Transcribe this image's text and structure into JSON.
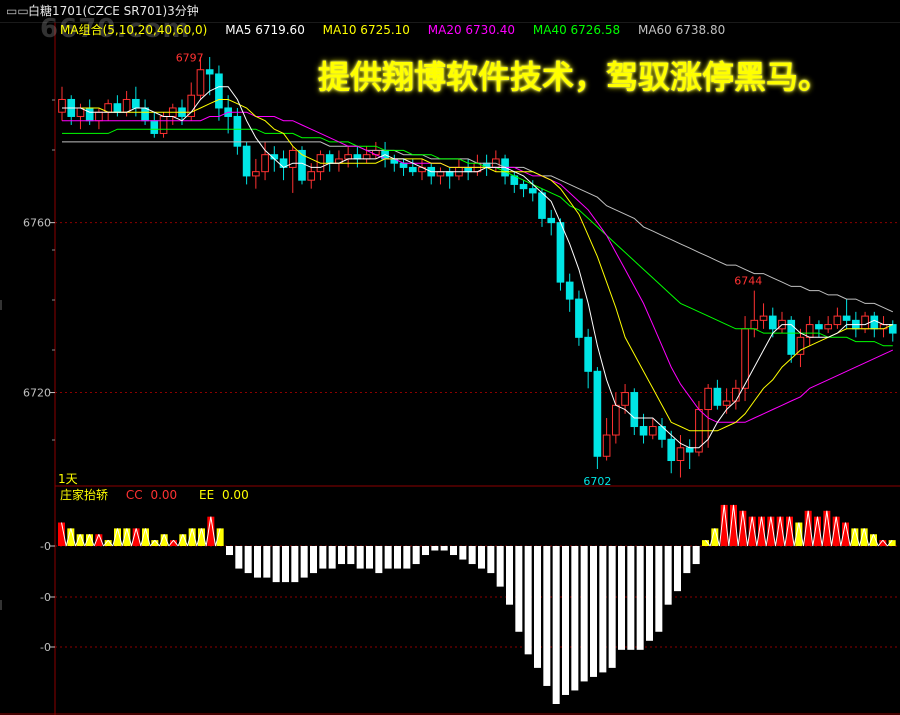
{
  "title_bar": {
    "icon": "window-icon",
    "text": "白糖1701(CZCE SR701)3分钟"
  },
  "watermark": "6670.com",
  "promo_text": "提供翔博软件技术，驾驭涨停黑马。",
  "ma_legend": {
    "group_label": "MA组合(5,10,20,40,60,0)",
    "ma5": "MA5 6719.60",
    "ma10": "MA10 6725.10",
    "ma20": "MA20 6730.40",
    "ma40": "MA40 6726.58",
    "ma60": "MA60 6738.80"
  },
  "period_label": "1天",
  "indicator_legend": {
    "name": "庄家抬轿",
    "cc": "CC",
    "cc_value": "0.00",
    "ee": "EE",
    "ee_value": "0.00"
  },
  "colors": {
    "up": "#ff3232",
    "down": "#00e5e5",
    "ma5": "#ffffff",
    "ma10": "#ffff00",
    "ma20": "#ff00ff",
    "ma40": "#00ff00",
    "ma60": "#c0c0c0",
    "grid": "#8b0000",
    "bar_pos_red": "#ff0000",
    "bar_pos_yellow": "#ffff00",
    "bar_neg": "#ffffff"
  },
  "chart_data": [
    {
      "type": "candlestick",
      "title": "白糖1701(CZCE SR701)3分钟",
      "y_ticks": [
        6720,
        6760
      ],
      "ylim": [
        6698,
        6803
      ],
      "annotations": [
        {
          "label": "6797",
          "value": 6797
        },
        {
          "label": "6744",
          "value": 6744
        },
        {
          "label": "6702",
          "value": 6702
        }
      ],
      "candles": [
        [
          6786,
          6789,
          6792,
          6784
        ],
        [
          6789,
          6785,
          6790,
          6783
        ],
        [
          6785,
          6787,
          6788,
          6782
        ],
        [
          6787,
          6784,
          6789,
          6783
        ],
        [
          6784,
          6786,
          6787,
          6782
        ],
        [
          6786,
          6788,
          6789,
          6784
        ],
        [
          6788,
          6786,
          6790,
          6785
        ],
        [
          6786,
          6789,
          6791,
          6785
        ],
        [
          6789,
          6787,
          6792,
          6785
        ],
        [
          6787,
          6784,
          6789,
          6783
        ],
        [
          6784,
          6781,
          6786,
          6780
        ],
        [
          6781,
          6785,
          6786,
          6780
        ],
        [
          6785,
          6787,
          6788,
          6783
        ],
        [
          6787,
          6785,
          6789,
          6783
        ],
        [
          6785,
          6790,
          6793,
          6784
        ],
        [
          6790,
          6796,
          6799,
          6789
        ],
        [
          6796,
          6795,
          6799,
          6790
        ],
        [
          6795,
          6787,
          6797,
          6784
        ],
        [
          6787,
          6785,
          6790,
          6781
        ],
        [
          6785,
          6778,
          6787,
          6776
        ],
        [
          6778,
          6771,
          6779,
          6769
        ],
        [
          6771,
          6772,
          6775,
          6768
        ],
        [
          6772,
          6776,
          6779,
          6770
        ],
        [
          6776,
          6775,
          6778,
          6772
        ],
        [
          6775,
          6773,
          6777,
          6770
        ],
        [
          6773,
          6777,
          6778,
          6767
        ],
        [
          6777,
          6770,
          6778,
          6769
        ],
        [
          6770,
          6772,
          6774,
          6768
        ],
        [
          6772,
          6776,
          6777,
          6770
        ],
        [
          6776,
          6774,
          6777,
          6772
        ],
        [
          6774,
          6775,
          6777,
          6772
        ],
        [
          6775,
          6776,
          6778,
          6773
        ],
        [
          6776,
          6775,
          6778,
          6773
        ],
        [
          6775,
          6776,
          6778,
          6774
        ],
        [
          6776,
          6777,
          6779,
          6775
        ],
        [
          6777,
          6775,
          6779,
          6773
        ],
        [
          6775,
          6774,
          6776,
          6772
        ],
        [
          6774,
          6773,
          6775,
          6771
        ],
        [
          6773,
          6772,
          6775,
          6771
        ],
        [
          6772,
          6773,
          6775,
          6770
        ],
        [
          6773,
          6771,
          6774,
          6769
        ],
        [
          6771,
          6772,
          6773,
          6769
        ],
        [
          6772,
          6771,
          6773,
          6768
        ],
        [
          6771,
          6773,
          6775,
          6770
        ],
        [
          6773,
          6772,
          6775,
          6770
        ],
        [
          6772,
          6774,
          6776,
          6771
        ],
        [
          6774,
          6773,
          6776,
          6771
        ],
        [
          6773,
          6775,
          6777,
          6772
        ],
        [
          6775,
          6771,
          6776,
          6769
        ],
        [
          6771,
          6769,
          6772,
          6767
        ],
        [
          6769,
          6768,
          6770,
          6766
        ],
        [
          6768,
          6767,
          6770,
          6765
        ],
        [
          6767,
          6761,
          6768,
          6759
        ],
        [
          6761,
          6760,
          6763,
          6757
        ],
        [
          6760,
          6746,
          6761,
          6744
        ],
        [
          6746,
          6742,
          6748,
          6739
        ],
        [
          6742,
          6733,
          6744,
          6731
        ],
        [
          6733,
          6725,
          6735,
          6721
        ],
        [
          6725,
          6705,
          6726,
          6702
        ],
        [
          6705,
          6710,
          6714,
          6704
        ],
        [
          6710,
          6717,
          6720,
          6708
        ],
        [
          6717,
          6720,
          6722,
          6715
        ],
        [
          6720,
          6712,
          6721,
          6710
        ],
        [
          6712,
          6710,
          6715,
          6708
        ],
        [
          6710,
          6712,
          6714,
          6709
        ],
        [
          6712,
          6709,
          6714,
          6707
        ],
        [
          6709,
          6704,
          6711,
          6701
        ],
        [
          6704,
          6707,
          6710,
          6700
        ],
        [
          6707,
          6706,
          6709,
          6702
        ],
        [
          6706,
          6716,
          6718,
          6705
        ],
        [
          6716,
          6721,
          6722,
          6707
        ],
        [
          6721,
          6717,
          6723,
          6716
        ],
        [
          6717,
          6718,
          6721,
          6715
        ],
        [
          6718,
          6721,
          6723,
          6716
        ],
        [
          6721,
          6735,
          6738,
          6718
        ],
        [
          6735,
          6737,
          6744,
          6733
        ],
        [
          6737,
          6738,
          6741,
          6735
        ],
        [
          6738,
          6735,
          6740,
          6733
        ],
        [
          6735,
          6737,
          6739,
          6734
        ],
        [
          6737,
          6729,
          6738,
          6727
        ],
        [
          6729,
          6733,
          6735,
          6726
        ],
        [
          6733,
          6736,
          6738,
          6731
        ],
        [
          6736,
          6735,
          6737,
          6733
        ],
        [
          6735,
          6736,
          6738,
          6734
        ],
        [
          6736,
          6738,
          6740,
          6735
        ],
        [
          6738,
          6737,
          6742,
          6735
        ],
        [
          6737,
          6735,
          6739,
          6733
        ],
        [
          6735,
          6738,
          6739,
          6734
        ],
        [
          6738,
          6735,
          6739,
          6733
        ],
        [
          6735,
          6736,
          6738,
          6733
        ],
        [
          6736,
          6734,
          6737,
          6732
        ]
      ],
      "ma5": [
        6787,
        6787,
        6787,
        6786,
        6786,
        6786,
        6786,
        6786,
        6787,
        6787,
        6786,
        6785,
        6785,
        6784,
        6786,
        6789,
        6791,
        6792,
        6792,
        6789,
        6784,
        6780,
        6777,
        6775,
        6773,
        6774,
        6774,
        6773,
        6773,
        6774,
        6774,
        6775,
        6775,
        6775,
        6775,
        6776,
        6775,
        6775,
        6774,
        6773,
        6772,
        6772,
        6772,
        6772,
        6772,
        6772,
        6773,
        6773,
        6773,
        6772,
        6771,
        6769,
        6767,
        6765,
        6760,
        6755,
        6749,
        6741,
        6731,
        6723,
        6717,
        6716,
        6714,
        6714,
        6714,
        6712,
        6710,
        6708,
        6707,
        6707,
        6709,
        6713,
        6716,
        6718,
        6722,
        6726,
        6730,
        6734,
        6736,
        6736,
        6734,
        6733,
        6733,
        6733,
        6734,
        6736,
        6736,
        6736,
        6737,
        6736,
        6736
      ],
      "ma10": [
        6787,
        6787,
        6787,
        6787,
        6787,
        6786,
        6786,
        6786,
        6786,
        6786,
        6786,
        6786,
        6786,
        6786,
        6786,
        6787,
        6788,
        6789,
        6789,
        6788,
        6787,
        6785,
        6784,
        6782,
        6781,
        6778,
        6776,
        6775,
        6774,
        6774,
        6774,
        6774,
        6774,
        6774,
        6774,
        6775,
        6775,
        6775,
        6775,
        6775,
        6774,
        6774,
        6773,
        6773,
        6773,
        6773,
        6773,
        6772,
        6772,
        6772,
        6772,
        6772,
        6771,
        6770,
        6768,
        6765,
        6762,
        6757,
        6752,
        6746,
        6740,
        6733,
        6729,
        6725,
        6721,
        6717,
        6713,
        6712,
        6711,
        6711,
        6711,
        6711,
        6712,
        6713,
        6715,
        6718,
        6721,
        6723,
        6726,
        6728,
        6730,
        6731,
        6732,
        6733,
        6734,
        6735,
        6735,
        6735,
        6735,
        6735,
        6736
      ],
      "ma20": [
        6784,
        6784,
        6784,
        6784,
        6784,
        6784,
        6784,
        6784,
        6784,
        6784,
        6784,
        6784,
        6784,
        6784,
        6784,
        6784,
        6785,
        6785,
        6786,
        6786,
        6786,
        6785,
        6785,
        6785,
        6784,
        6784,
        6783,
        6782,
        6781,
        6780,
        6779,
        6778,
        6778,
        6777,
        6776,
        6775,
        6775,
        6774,
        6774,
        6774,
        6774,
        6774,
        6773,
        6773,
        6773,
        6773,
        6773,
        6773,
        6773,
        6773,
        6772,
        6771,
        6771,
        6770,
        6769,
        6767,
        6765,
        6763,
        6760,
        6757,
        6753,
        6749,
        6745,
        6741,
        6736,
        6731,
        6726,
        6722,
        6719,
        6716,
        6714,
        6713,
        6713,
        6713,
        6713,
        6714,
        6715,
        6716,
        6717,
        6718,
        6719,
        6721,
        6722,
        6723,
        6724,
        6725,
        6726,
        6727,
        6728,
        6729,
        6730
      ],
      "ma40": [
        6781,
        6781,
        6781,
        6781,
        6781,
        6781,
        6782,
        6782,
        6782,
        6782,
        6782,
        6782,
        6782,
        6782,
        6782,
        6782,
        6782,
        6782,
        6782,
        6782,
        6782,
        6782,
        6781,
        6781,
        6781,
        6781,
        6780,
        6780,
        6780,
        6779,
        6779,
        6779,
        6778,
        6778,
        6778,
        6777,
        6777,
        6777,
        6776,
        6776,
        6776,
        6775,
        6775,
        6775,
        6774,
        6774,
        6773,
        6773,
        6772,
        6771,
        6770,
        6769,
        6768,
        6767,
        6766,
        6764,
        6763,
        6761,
        6759,
        6757,
        6755,
        6753,
        6751,
        6749,
        6747,
        6745,
        6743,
        6741,
        6740,
        6739,
        6738,
        6737,
        6736,
        6735,
        6735,
        6735,
        6734,
        6734,
        6734,
        6734,
        6734,
        6734,
        6734,
        6733,
        6733,
        6733,
        6732,
        6732,
        6732,
        6731,
        6731
      ],
      "ma60": [
        6779,
        6779,
        6779,
        6779,
        6779,
        6779,
        6779,
        6779,
        6779,
        6779,
        6779,
        6779,
        6779,
        6779,
        6779,
        6779,
        6779,
        6779,
        6779,
        6779,
        6779,
        6779,
        6779,
        6779,
        6779,
        6779,
        6779,
        6779,
        6779,
        6778,
        6778,
        6778,
        6778,
        6777,
        6777,
        6777,
        6777,
        6776,
        6776,
        6776,
        6775,
        6775,
        6775,
        6775,
        6775,
        6774,
        6774,
        6774,
        6773,
        6773,
        6773,
        6772,
        6771,
        6771,
        6770,
        6769,
        6768,
        6767,
        6766,
        6764,
        6763,
        6762,
        6761,
        6759,
        6758,
        6757,
        6756,
        6755,
        6754,
        6753,
        6752,
        6751,
        6750,
        6750,
        6749,
        6748,
        6748,
        6747,
        6746,
        6745,
        6745,
        6744,
        6744,
        6743,
        6743,
        6742,
        6742,
        6741,
        6741,
        6740,
        6739
      ]
    },
    {
      "type": "bar",
      "title": "庄家抬轿",
      "y_ticks_label": "-0",
      "values": [
        4,
        3,
        2,
        2,
        2,
        1,
        3,
        3,
        3,
        3,
        1,
        2,
        1,
        2,
        3,
        3,
        5,
        3,
        -2,
        -5,
        -6,
        -7,
        -7,
        -8,
        -8,
        -8,
        -7,
        -6,
        -5,
        -5,
        -4,
        -4,
        -5,
        -5,
        -6,
        -5,
        -5,
        -5,
        -4,
        -2,
        -1,
        -1,
        -2,
        -3,
        -4,
        -5,
        -6,
        -9,
        -13,
        -19,
        -24,
        -27,
        -31,
        -35,
        -33,
        -32,
        -30,
        -29,
        -28,
        -27,
        -23,
        -23,
        -23,
        -21,
        -19,
        -13,
        -10,
        -6,
        -4,
        1,
        3,
        7,
        7,
        6,
        5,
        5,
        5,
        5,
        5,
        4,
        6,
        5,
        6,
        5,
        4,
        3,
        3,
        2,
        1,
        1
      ],
      "colors_pattern": "red/yellow positive, white negative"
    }
  ]
}
